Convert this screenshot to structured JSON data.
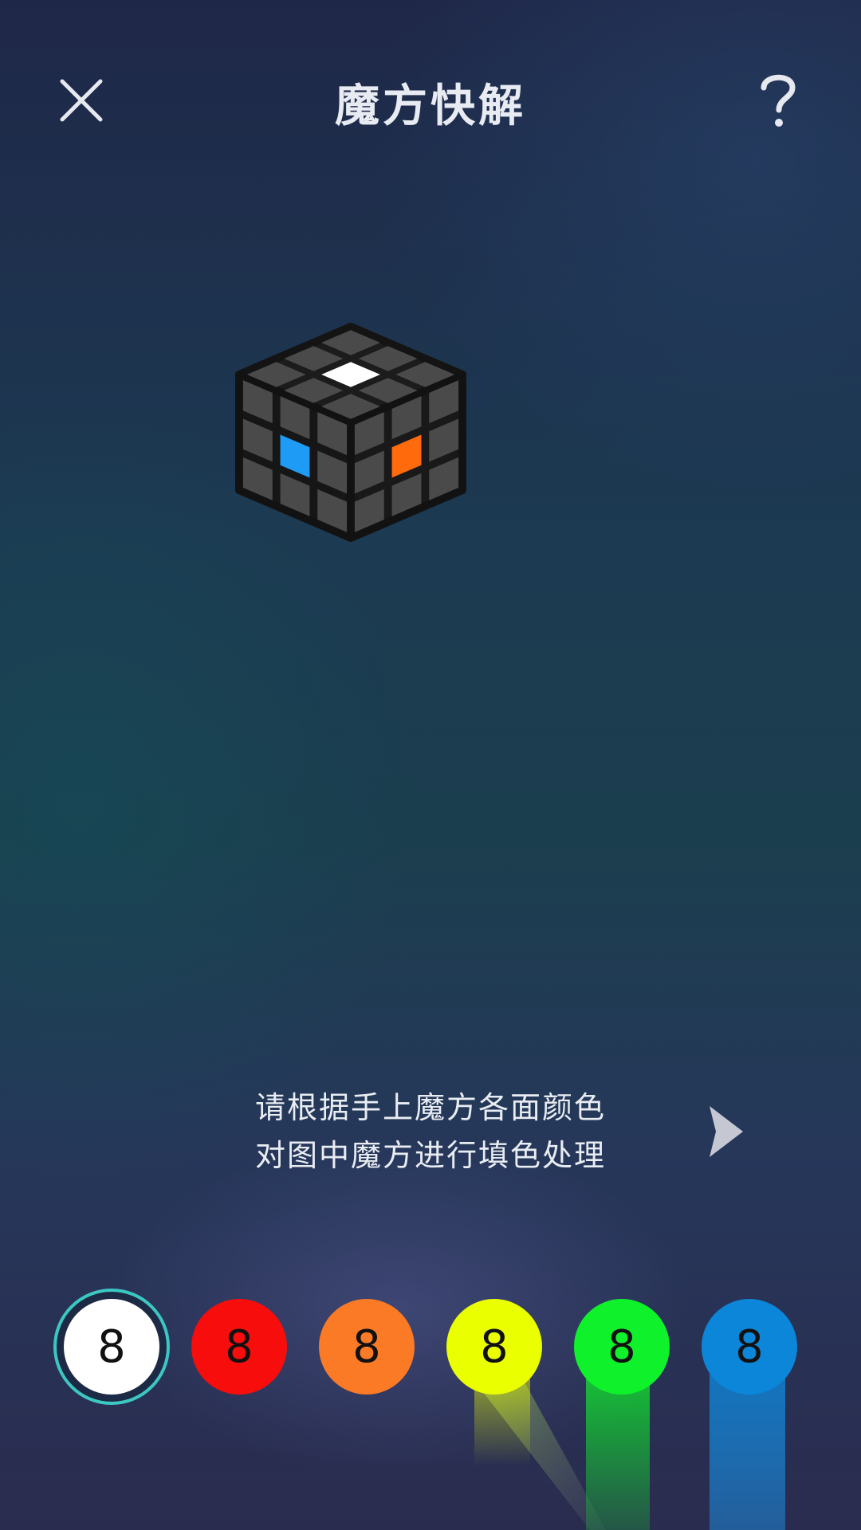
{
  "header": {
    "title": "魔方快解",
    "close_icon": "close-icon",
    "help_icon": "help-icon"
  },
  "cube": {
    "top_center_color": "#ffffff",
    "left_center_color": "#1e9bf5",
    "right_center_color": "#ff6a0d",
    "blank_sticker_color": "#4a4a4a"
  },
  "instruction": {
    "line1": "请根据手上魔方各面颜色",
    "line2": "对图中魔方进行填色处理",
    "next_icon": "next-arrow-icon"
  },
  "palette": {
    "selected_index": 0,
    "swatches": [
      {
        "label": "8",
        "color": "#ffffff",
        "name": "white"
      },
      {
        "label": "8",
        "color": "#f80d0d",
        "name": "red"
      },
      {
        "label": "8",
        "color": "#fb7a26",
        "name": "orange"
      },
      {
        "label": "8",
        "color": "#eaff00",
        "name": "yellow"
      },
      {
        "label": "8",
        "color": "#0ff12a",
        "name": "green"
      },
      {
        "label": "8",
        "color": "#0b86d9",
        "name": "blue"
      }
    ]
  }
}
